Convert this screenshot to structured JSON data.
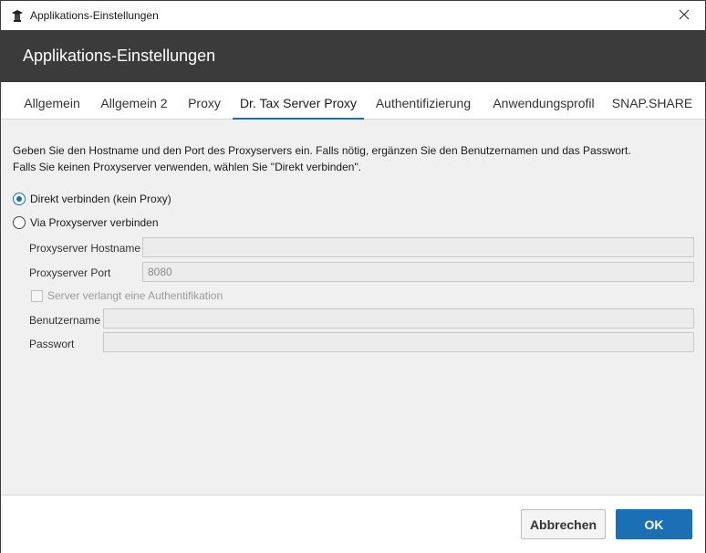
{
  "window": {
    "title": "Applikations-Einstellungen",
    "close_label": "✕"
  },
  "header": {
    "title": "Applikations-Einstellungen"
  },
  "tabs": [
    {
      "label": "Allgemein"
    },
    {
      "label": "Allgemein 2"
    },
    {
      "label": "Proxy"
    },
    {
      "label": "Dr. Tax Server Proxy",
      "active": true
    },
    {
      "label": "Authentifizierung"
    },
    {
      "label": "Anwendungsprofil"
    },
    {
      "label": "SNAP.SHARE"
    }
  ],
  "content": {
    "description_line1": "Geben Sie den Hostname und den Port des Proxyservers ein. Falls nötig, ergänzen Sie den Benutzernamen und das Passwort.",
    "description_line2": "Falls Sie keinen Proxyserver verwenden, wählen Sie \"Direkt verbinden\".",
    "radio_direct": {
      "label": "Direkt verbinden (kein Proxy)",
      "checked": true
    },
    "radio_proxy": {
      "label": "Via Proxyserver verbinden",
      "checked": false
    },
    "hostname": {
      "label": "Proxyserver Hostname",
      "value": ""
    },
    "port": {
      "label": "Proxyserver Port",
      "value": "8080"
    },
    "auth_checkbox": {
      "label": "Server verlangt eine Authentifikation",
      "checked": false
    },
    "username": {
      "label": "Benutzername",
      "value": ""
    },
    "password": {
      "label": "Passwort",
      "value": ""
    }
  },
  "footer": {
    "cancel_label": "Abbrechen",
    "ok_label": "OK"
  },
  "colors": {
    "header_bg": "#3b3b3b",
    "accent": "#1a6fb5"
  }
}
